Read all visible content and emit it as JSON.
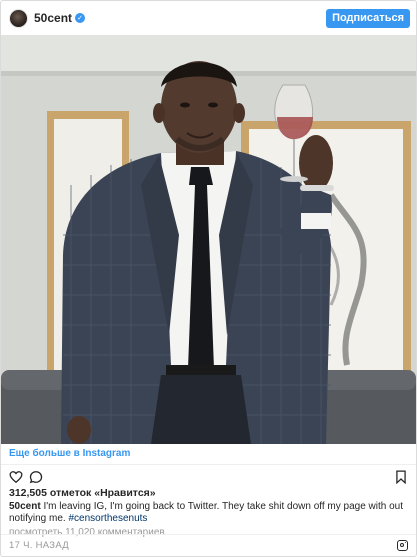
{
  "post": {
    "username": "50cent",
    "verified_glyph": "✓",
    "follow_label": "Подписаться",
    "photo_alt": "",
    "more_link": "Еще больше в Instagram",
    "likes": "312,505 отметок «Нравится»",
    "caption_author": "50cent",
    "caption_text": " I'm leaving IG, I'm going back to Twitter. They take shit down off my page with out notifying me. ",
    "caption_hashtag": "#censorthesenuts",
    "view_comments": "посмотреть 11,020 комментариев",
    "timestamp": "17 Ч. НАЗАД"
  },
  "icons": {
    "like": "heart-icon",
    "comment": "comment-icon",
    "save": "bookmark-icon",
    "brand": "instagram-logo-icon"
  },
  "colors": {
    "accent": "#3897f0",
    "text": "#262626",
    "muted": "#999999",
    "hashtag": "#003569",
    "border": "#dbdbdb"
  }
}
